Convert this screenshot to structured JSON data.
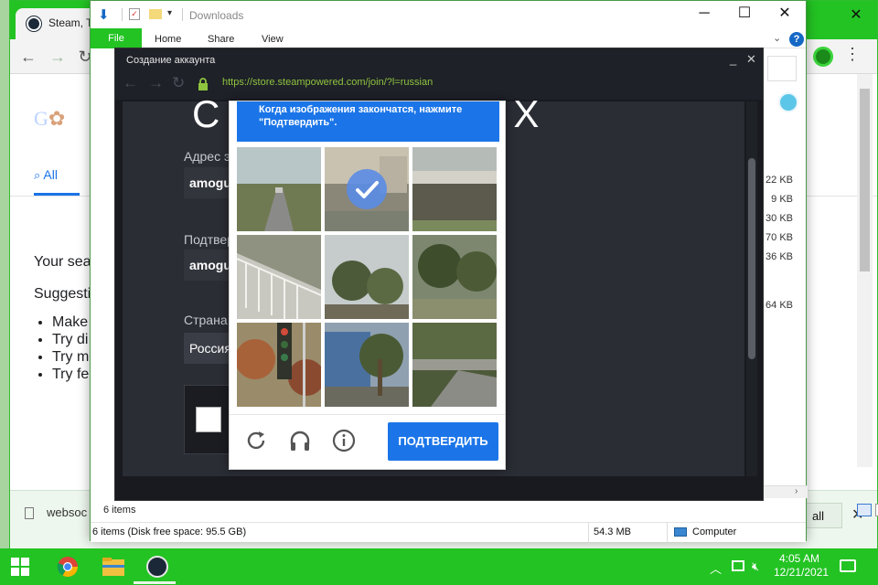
{
  "chrome": {
    "tab_title": "Steam, T",
    "search_tab_all": "All",
    "results_intro": "Your sea",
    "suggestions_label": "Suggesti",
    "suggestions": [
      "Make",
      "Try di",
      "Try m",
      "Try fe"
    ],
    "download_file": "websoc",
    "show_all": "all",
    "icons": [
      "steam-icon",
      "back-arrow-icon",
      "forward-arrow-icon",
      "reload-icon",
      "profile-icon",
      "kebab-menu-icon",
      "close-icon"
    ]
  },
  "explorer": {
    "title": "Downloads",
    "ribbon_tabs": [
      "File",
      "Home",
      "Share",
      "View"
    ],
    "file_sizes": [
      "22 KB",
      "9 KB",
      "30 KB",
      "70 KB",
      "36 KB",
      "64 KB"
    ],
    "items_count": "6 items",
    "status_items": "6 items (Disk free space: 95.5 GB)",
    "status_size": "54.3 MB",
    "status_location": "Computer"
  },
  "steam": {
    "window_title": "Создание аккаунта",
    "url": "https://store.steampowered.com/join/?l=russian",
    "heading_left": "С",
    "heading_right": "Х",
    "email_label": "Адрес э",
    "email_value": "amogus",
    "confirm_label": "Подтвер",
    "confirm_value": "amogus",
    "country_label": "Страна",
    "country_value": "Россия"
  },
  "captcha": {
    "instruction": "Когда изображения закончатся, нажмите \"Подтвердить\".",
    "submit_label": "ПОДТВЕРДИТЬ",
    "tiles_selected": [
      false,
      true,
      false,
      false,
      false,
      false,
      false,
      false,
      false
    ],
    "icons": [
      "refresh-icon",
      "headphones-icon",
      "info-icon"
    ]
  },
  "taskbar": {
    "time": "4:05 AM",
    "date": "12/21/2021",
    "apps": [
      "windows-start-icon",
      "chrome-icon",
      "file-explorer-icon",
      "steam-icon"
    ]
  },
  "colors": {
    "accent_green": "#23c323",
    "captcha_blue": "#1b75e8",
    "steam_url_green": "#8fc43f",
    "steam_bg": "#181a20"
  }
}
